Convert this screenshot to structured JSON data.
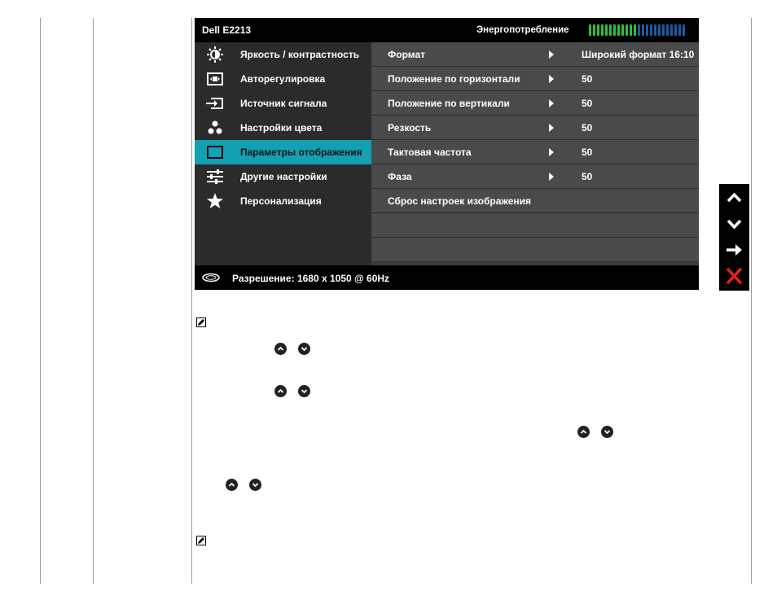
{
  "osd": {
    "title": "Dell E2213",
    "energy_label": "Энергопотребление",
    "energy_level": 0.5,
    "menu": [
      {
        "label": "Яркость / контрастность",
        "icon": "brightness-icon"
      },
      {
        "label": "Авторегулировка",
        "icon": "auto-adjust-icon"
      },
      {
        "label": "Источник сигнала",
        "icon": "input-source-icon"
      },
      {
        "label": "Настройки цвета",
        "icon": "color-settings-icon"
      },
      {
        "label": "Параметры отображения",
        "icon": "display-settings-icon",
        "selected": true
      },
      {
        "label": "Другие настройки",
        "icon": "other-settings-icon"
      },
      {
        "label": "Персонализация",
        "icon": "personalize-star-icon"
      }
    ],
    "submenu": [
      {
        "label": "Формат",
        "value": "Широкий формат 16:10",
        "arrow": true
      },
      {
        "label": "Положение по горизонтали",
        "value": "50",
        "arrow": true
      },
      {
        "label": "Положение по вертикали",
        "value": "50",
        "arrow": true
      },
      {
        "label": "Резкость",
        "value": "50",
        "arrow": true
      },
      {
        "label": "Тактовая частота",
        "value": "50",
        "arrow": true
      },
      {
        "label": "Фаза",
        "value": "50",
        "arrow": true
      },
      {
        "label": "Сброс настроек изображения",
        "value": "",
        "arrow": false
      },
      {
        "label": "",
        "value": "",
        "arrow": false
      },
      {
        "label": "",
        "value": "",
        "arrow": false
      }
    ],
    "footer": "Разрешение: 1680 x 1050 @ 60Hz"
  },
  "controls": [
    "up-arrow-icon",
    "down-arrow-icon",
    "enter-arrow-icon",
    "exit-x-icon"
  ],
  "colors": {
    "selected_bg": "#13a0b3",
    "energy_on": "#2fbf3a",
    "energy_off": "#1e5aa0",
    "exit_red": "#e02020"
  }
}
